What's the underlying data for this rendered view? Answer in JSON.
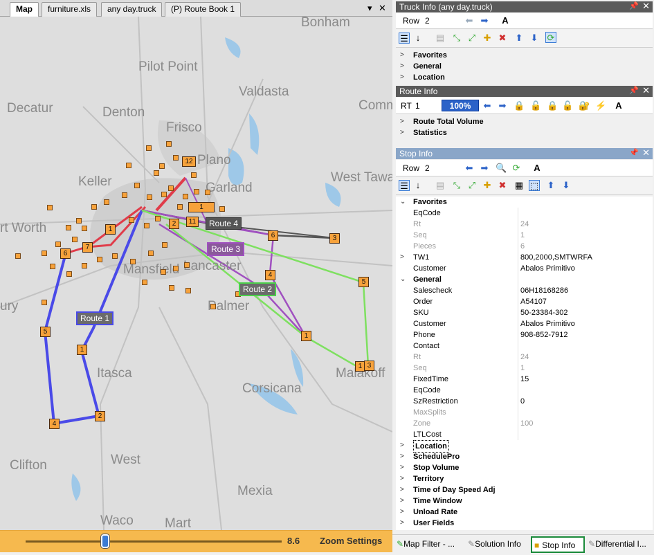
{
  "doc_tabs": {
    "tabs": [
      {
        "label": "Map"
      },
      {
        "label": "furniture.xls"
      },
      {
        "label": "any day.truck"
      },
      {
        "label": "(P) Route Book 1"
      }
    ],
    "dropdown_glyph": "▾",
    "close_glyph": "✕"
  },
  "map": {
    "cities": [
      "Bonham",
      "Pilot Point",
      "Decatur",
      "Denton",
      "Valdasta",
      "Frisco",
      "Comm",
      "Plano",
      "Keller",
      "Garland",
      "West Tawakoni",
      "rt Worth",
      "Mansfield",
      "Lancaster",
      "Palmer",
      "ury",
      "Itasca",
      "Corsicana",
      "Malakoff",
      "Clifton",
      "West",
      "Mexia",
      "Waco",
      "Mart"
    ],
    "route_labels": {
      "route1": "Route 1",
      "route2": "Route 2",
      "route3": "Route 3",
      "route4": "Route 4"
    },
    "stop_numbers": {
      "r1_7": "7",
      "r1_6": "6",
      "r1_1": "1",
      "r1_5": "5",
      "r1_4": "4",
      "r1_2": "2",
      "r1_b1": "1",
      "r1_12": "12",
      "r1_2b": "2",
      "r1_11": "11",
      "r1_13": "1",
      "r4_3": "3",
      "r4_6": "6",
      "r3_4": "4",
      "r2_1": "1",
      "r2_5": "5",
      "r2_13a": "1",
      "r2_13b": "3"
    },
    "route_colors": {
      "route1": "#4a4ae8",
      "route2": "#7ee060",
      "route3": "#a050c0",
      "route4": "#555555",
      "red": "#e03c4a"
    }
  },
  "zoom": {
    "value": "8.6",
    "label": "Zoom Settings",
    "slider_fraction": 0.31
  },
  "truck_info": {
    "title": "Truck Info (any day.truck)",
    "row_label": "Row",
    "row_value": "2",
    "categories": [
      "Favorites",
      "General",
      "Location"
    ]
  },
  "route_info": {
    "title": "Route Info",
    "rt_label": "RT",
    "rt_value": "1",
    "percent": "100%",
    "categories": [
      "Route Total Volume",
      "Statistics"
    ]
  },
  "stop_info": {
    "title": "Stop Info",
    "row_label": "Row",
    "row_value": "2",
    "favorites": {
      "label": "Favorites",
      "props": [
        {
          "name": "EqCode",
          "value": ""
        },
        {
          "name": "Rt",
          "value": "24"
        },
        {
          "name": "Seq",
          "value": "1"
        },
        {
          "name": "Pieces",
          "value": "6"
        },
        {
          "name": "TW1",
          "value": "800,2000,SMTWRFA"
        },
        {
          "name": "Customer",
          "value": "Abalos Primitivo"
        }
      ]
    },
    "general": {
      "label": "General",
      "props": [
        {
          "name": "Salescheck",
          "value": "06H18168286"
        },
        {
          "name": "Order",
          "value": "A54107"
        },
        {
          "name": "SKU",
          "value": "50-23384-302"
        },
        {
          "name": "Customer",
          "value": "Abalos Primitivo"
        },
        {
          "name": "Phone",
          "value": "908-852-7912"
        },
        {
          "name": "Contact",
          "value": ""
        },
        {
          "name": "Rt",
          "value": "24"
        },
        {
          "name": "Seq",
          "value": "1"
        },
        {
          "name": "FixedTime",
          "value": "15"
        },
        {
          "name": "EqCode",
          "value": ""
        },
        {
          "name": "SzRestriction",
          "value": "0"
        },
        {
          "name": "MaxSplits",
          "value": ""
        },
        {
          "name": "Zone",
          "value": "100"
        },
        {
          "name": "LTLCost",
          "value": ""
        }
      ]
    },
    "collapsed": [
      "Location",
      "SchedulePro",
      "Stop Volume",
      "Territory",
      "Time of Day Speed Adj",
      "Time Window",
      "Unload Rate",
      "User Fields"
    ]
  },
  "bottom_tabs": [
    {
      "label": "Map Filter - ..."
    },
    {
      "label": "Solution Info"
    },
    {
      "label": "Stop Info"
    },
    {
      "label": "Differential I..."
    }
  ]
}
